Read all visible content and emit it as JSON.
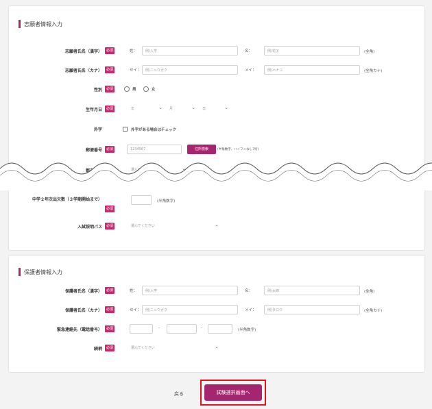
{
  "applicant": {
    "section_title": "志願者情報入力",
    "required_badge": "必須",
    "name_kanji": {
      "label": "志願者氏名（漢字）",
      "sei_prefix": "姓：",
      "mei_prefix": "名：",
      "sei_placeholder": "例)入学",
      "mei_placeholder": "例)花子",
      "note": "(全角)"
    },
    "name_kana": {
      "label": "志願者氏名（カナ）",
      "sei_prefix": "セイ：",
      "mei_prefix": "メイ：",
      "sei_placeholder": "例)ニュウガク",
      "mei_placeholder": "例)ハナコ",
      "note": "(全角カナ)"
    },
    "gender": {
      "label": "性別",
      "male": "男",
      "female": "女"
    },
    "birthdate": {
      "label": "生年月日",
      "year": "年",
      "month": "月",
      "day": "日"
    },
    "foreign": {
      "label": "外字",
      "check_label": "外字がある場合はチェック"
    },
    "postal": {
      "label": "郵便番号",
      "placeholder": "1234567",
      "button": "住所検索",
      "note": "(半角数字、ハイフンなし7桁)"
    },
    "prefecture": {
      "label": "都道府県",
      "select_placeholder": "選んでください"
    },
    "absence": {
      "label": "中学２年次出欠数（３学期開始まで）",
      "note": "(半角数字)"
    },
    "exam_pass": {
      "label": "入試説明パス",
      "select_placeholder": "選んでください"
    }
  },
  "guardian": {
    "section_title": "保護者情報入力",
    "name_kanji": {
      "label": "保護者氏名（漢字）",
      "sei_prefix": "姓：",
      "mei_prefix": "名：",
      "sei_placeholder": "例)入学",
      "mei_placeholder": "例)太郎",
      "note": "(全角)"
    },
    "name_kana": {
      "label": "保護者氏名（カナ）",
      "sei_prefix": "セイ：",
      "mei_prefix": "メイ：",
      "sei_placeholder": "例)ニュウガク",
      "mei_placeholder": "例)タロウ",
      "note": "(全角カナ)"
    },
    "phone": {
      "label": "緊急連絡先（電話番号）",
      "dash": "-",
      "note": "(半角数字)"
    },
    "relation": {
      "label": "続柄",
      "select_placeholder": "選んでください"
    }
  },
  "footer": {
    "back_label": "戻る",
    "confirm_label": "試験選択画面へ"
  }
}
